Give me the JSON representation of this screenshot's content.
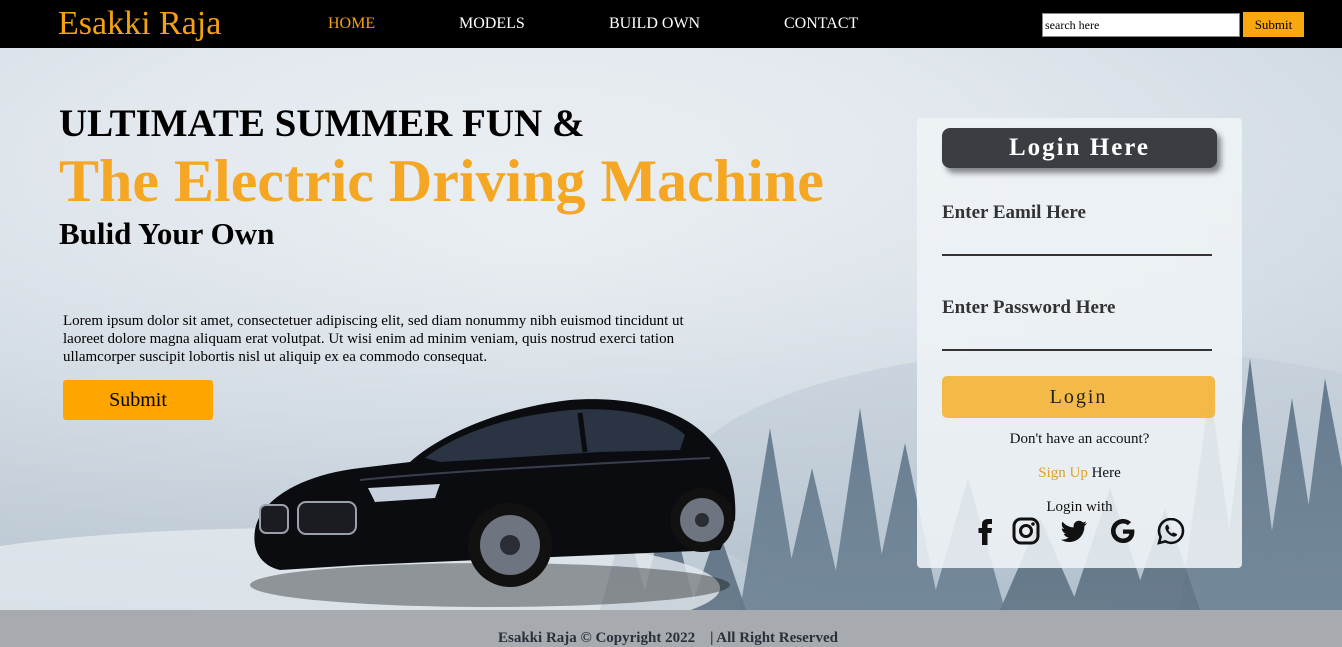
{
  "nav": {
    "logo": "Esakki Raja",
    "links": [
      "HOME",
      "MODELS",
      "BUILD OWN",
      "CONTACT"
    ],
    "search_placeholder": "search here",
    "search_button": "Submit"
  },
  "hero": {
    "line1": "ULTIMATE SUMMER FUN &",
    "line2": "The Electric Driving Machine",
    "line3": "Bulid Your Own",
    "paragraph": "Lorem ipsum dolor sit amet, consectetuer adipiscing elit, sed diam nonummy nibh euismod tincidunt ut laoreet dolore magna aliquam erat volutpat. Ut wisi enim ad minim veniam, quis nostrud exerci tation ullamcorper suscipit lobortis nisl ut aliquip ex ea commodo consequat.",
    "button": "Submit"
  },
  "login": {
    "title": "Login Here",
    "email_label": "Enter Eamil Here",
    "password_label": "Enter Password Here",
    "button": "Login",
    "no_account": "Don't have an account?",
    "signup_link": "Sign Up",
    "signup_suffix": " Here",
    "login_with": "Login with",
    "social_icons": [
      "facebook-icon",
      "instagram-icon",
      "twitter-icon",
      "google-icon",
      "whatsapp-icon"
    ]
  },
  "footer": {
    "text": "Esakki Raja © Copyright 2022    | All Right Reserved"
  },
  "colors": {
    "accent": "#f5a20f",
    "navbar": "#000000",
    "card_title": "#3a3d42",
    "login_button": "#f5b028"
  }
}
